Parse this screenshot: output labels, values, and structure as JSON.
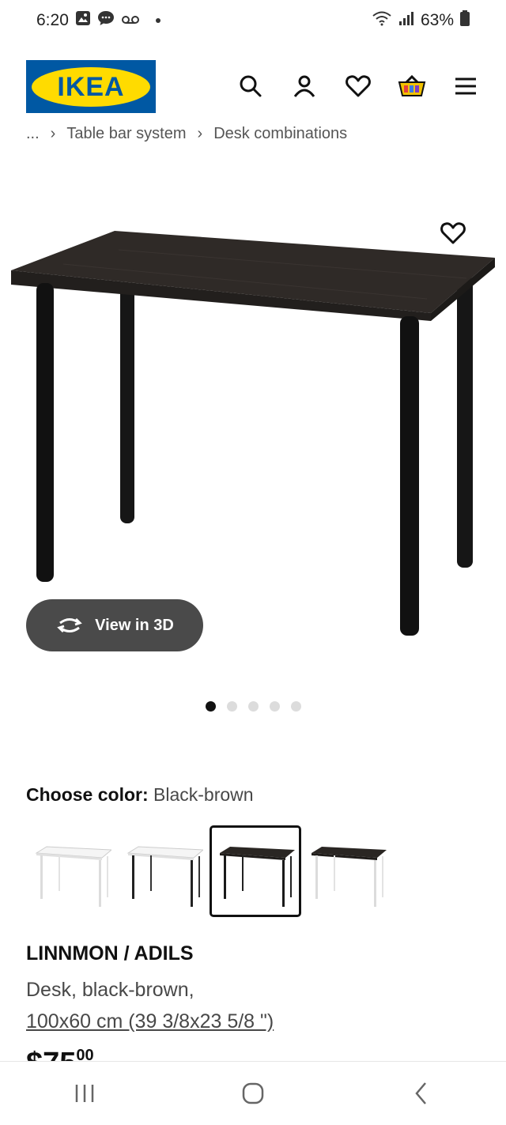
{
  "status_bar": {
    "time": "6:20",
    "battery": "63%",
    "icons": [
      "gallery-icon",
      "message-icon",
      "voicemail-icon",
      "wifi-icon",
      "signal-icon",
      "battery-icon"
    ]
  },
  "header": {
    "logo_text": "IKEA",
    "icons": [
      "search-icon",
      "account-icon",
      "favorites-icon",
      "cart-icon",
      "menu-icon"
    ]
  },
  "breadcrumb": {
    "items": [
      "...",
      "Table bar system",
      "Desk combinations"
    ]
  },
  "gallery": {
    "view_3d_label": "View in 3D",
    "image_count": 5,
    "active_index": 0
  },
  "color_picker": {
    "label": "Choose color:",
    "selected_value": "Black-brown",
    "options": [
      {
        "name": "White",
        "top": "#f5f5f5",
        "legs": "#e8e8e8",
        "selected": false
      },
      {
        "name": "White / Black",
        "top": "#f5f5f5",
        "legs": "#222222",
        "selected": false
      },
      {
        "name": "Black-brown",
        "top": "#2a2623",
        "legs": "#1a1a1a",
        "selected": true
      },
      {
        "name": "Black-brown / White",
        "top": "#2a2623",
        "legs": "#e8e8e8",
        "selected": false
      }
    ]
  },
  "product": {
    "name": "LINNMON / ADILS",
    "description": "Desk, black-brown,",
    "size": "100x60 cm (39 3/8x23 5/8 \")",
    "price_main": "$75",
    "price_cents": "00"
  },
  "colors": {
    "ikea_blue": "#0058a3",
    "ikea_yellow": "#ffdb00",
    "desk_top": "#2a2623",
    "button_bg": "#4a4a4a"
  }
}
